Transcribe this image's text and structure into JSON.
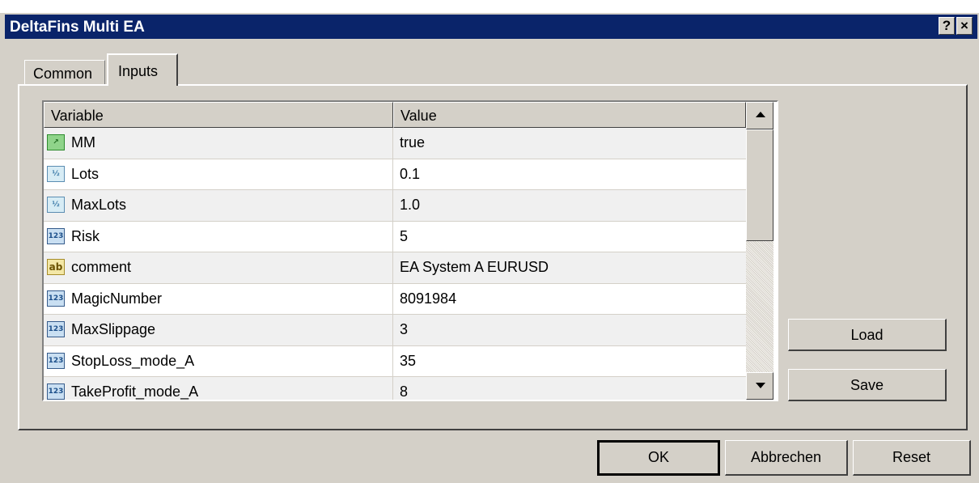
{
  "window": {
    "title": "DeltaFins Multi EA",
    "help_button": "?",
    "close_button": "×"
  },
  "tabs": [
    {
      "label": "Common",
      "active": false
    },
    {
      "label": "Inputs",
      "active": true
    }
  ],
  "table": {
    "columns": [
      "Variable",
      "Value"
    ],
    "rows": [
      {
        "variable": "MM",
        "value": "true",
        "type_icon": "bool-icon",
        "icon_glyph": "↗"
      },
      {
        "variable": "Lots",
        "value": "0.1",
        "type_icon": "double-icon",
        "icon_glyph": "½"
      },
      {
        "variable": "MaxLots",
        "value": "1.0",
        "type_icon": "double-icon",
        "icon_glyph": "½"
      },
      {
        "variable": "Risk",
        "value": "5",
        "type_icon": "int-icon",
        "icon_glyph": "123"
      },
      {
        "variable": "comment",
        "value": "EA System A EURUSD",
        "type_icon": "string-icon",
        "icon_glyph": "ab"
      },
      {
        "variable": "MagicNumber",
        "value": "8091984",
        "type_icon": "int-icon",
        "icon_glyph": "123"
      },
      {
        "variable": "MaxSlippage",
        "value": "3",
        "type_icon": "int-icon",
        "icon_glyph": "123"
      },
      {
        "variable": "StopLoss_mode_A",
        "value": "35",
        "type_icon": "int-icon",
        "icon_glyph": "123"
      },
      {
        "variable": "TakeProfit_mode_A",
        "value": "8",
        "type_icon": "int-icon",
        "icon_glyph": "123"
      }
    ]
  },
  "buttons": {
    "load": "Load",
    "save": "Save",
    "ok": "OK",
    "cancel": "Abbrechen",
    "reset": "Reset"
  }
}
